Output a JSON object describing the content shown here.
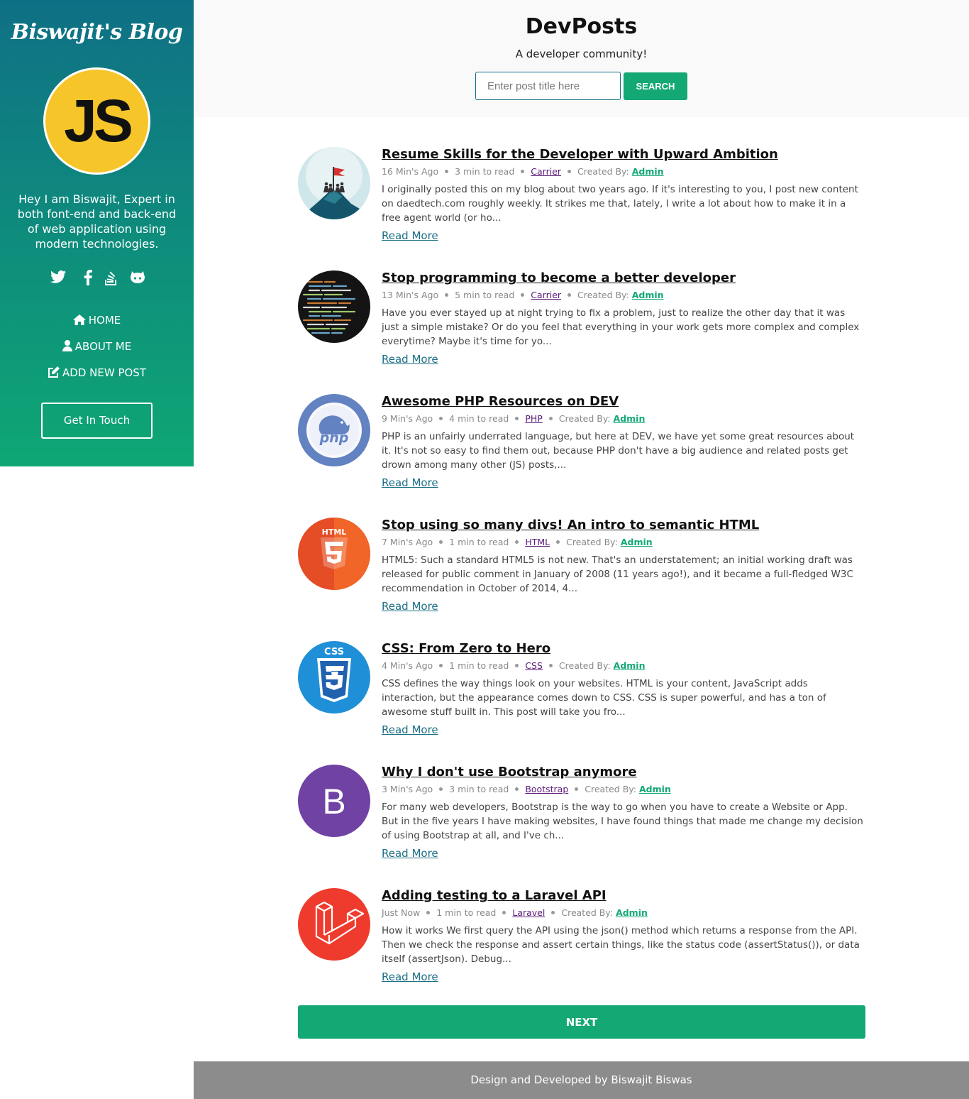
{
  "sidebar": {
    "brand": "Biswajit's Blog",
    "avatar_text": "JS",
    "bio": "Hey I am Biswajit, Expert in both font-end and back-end of web application using modern technologies.",
    "socials": [
      "twitter-icon",
      "facebook-icon",
      "stackoverflow-icon",
      "github-icon"
    ],
    "nav": [
      {
        "icon": "home-icon",
        "label": "HOME"
      },
      {
        "icon": "user-icon",
        "label": "ABOUT ME"
      },
      {
        "icon": "edit-icon",
        "label": "ADD NEW POST"
      }
    ],
    "cta": "Get In Touch"
  },
  "header": {
    "title": "DevPosts",
    "subtitle": "A developer community!",
    "search_placeholder": "Enter post title here",
    "search_label": "SEARCH"
  },
  "posts": [
    {
      "title": "Resume Skills for the Developer with Upward Ambition",
      "time": "16 Min's Ago",
      "read": "3 min to read",
      "category": "Carrier",
      "created_by": "Created By:",
      "author": "Admin",
      "excerpt": "I originally posted this on my blog about two years ago. If it's interesting to you, I post new content on daedtech.com roughly weekly. It strikes me that, lately, I write a lot about how to make it in a free agent world (or ho...",
      "read_more": "Read More",
      "thumb": "mountain-flag-image"
    },
    {
      "title": "Stop programming to become a better developer",
      "time": "13 Min's Ago",
      "read": "5 min to read",
      "category": "Carrier",
      "created_by": "Created By:",
      "author": "Admin",
      "excerpt": "Have you ever stayed up at night trying to fix a problem, just to realize the other day that it was just a simple mistake? Or do you feel that everything in your work gets more complex and complex everytime? Maybe it's time for yo...",
      "read_more": "Read More",
      "thumb": "code-screen-image"
    },
    {
      "title": "Awesome PHP Resources on DEV",
      "time": "9 Min's Ago",
      "read": "4 min to read",
      "category": "PHP",
      "created_by": "Created By:",
      "author": "Admin",
      "excerpt": "PHP is an unfairly underrated language, but here at DEV, we have yet some great resources about it. It's not so easy to find them out, because PHP don't have a big audience and related posts get drown among many other (JS) posts,...",
      "read_more": "Read More",
      "thumb": "php-logo",
      "thumb_text": "php"
    },
    {
      "title": "Stop using so many divs! An intro to semantic HTML",
      "time": "7 Min's Ago",
      "read": "1 min to read",
      "category": "HTML",
      "created_by": "Created By:",
      "author": "Admin",
      "excerpt": "HTML5: Such a standard HTML5 is not new. That's an understatement; an initial working draft was released for public comment in January of 2008 (11 years ago!), and it became a full-fledged W3C recommendation in October of 2014, 4...",
      "read_more": "Read More",
      "thumb": "html5-logo",
      "thumb_text": "HTML"
    },
    {
      "title": "CSS: From Zero to Hero",
      "time": "4 Min's Ago",
      "read": "1 min to read",
      "category": "CSS",
      "created_by": "Created By:",
      "author": "Admin",
      "excerpt": "CSS defines the way things look on your websites. HTML is your content, JavaScript adds interaction, but the appearance comes down to CSS. CSS is super powerful, and has a ton of awesome stuff built in. This post will take you fro...",
      "read_more": "Read More",
      "thumb": "css3-logo",
      "thumb_text": "CSS"
    },
    {
      "title": "Why I don't use Bootstrap anymore",
      "time": "3 Min's Ago",
      "read": "3 min to read",
      "category": "Bootstrap",
      "created_by": "Created By:",
      "author": "Admin",
      "excerpt": "For many web developers, Bootstrap is the way to go when you have to create a Website or App. But in the five years I have making websites, I have found things that made me change my decision of using Bootstrap at all, and I've ch...",
      "read_more": "Read More",
      "thumb": "bootstrap-logo",
      "thumb_text": "B"
    },
    {
      "title": "Adding testing to a Laravel API",
      "time": "Just Now",
      "read": "1 min to read",
      "category": "Laravel",
      "created_by": "Created By:",
      "author": "Admin",
      "excerpt": "How it works We first query the API using the json() method which returns a response from the API. Then we check the response and assert certain things, like the status code (assertStatus()), or data itself (assertJson). Debug...",
      "read_more": "Read More",
      "thumb": "laravel-logo"
    }
  ],
  "pagination": {
    "next_label": "NEXT"
  },
  "footer": {
    "text": "Design and Developed by Biswajit Biswas"
  },
  "colors": {
    "accent": "#13a874",
    "sidebar_top": "#0f7085",
    "sidebar_bottom": "#0ea774",
    "footer_bg": "#8c8c8c"
  }
}
